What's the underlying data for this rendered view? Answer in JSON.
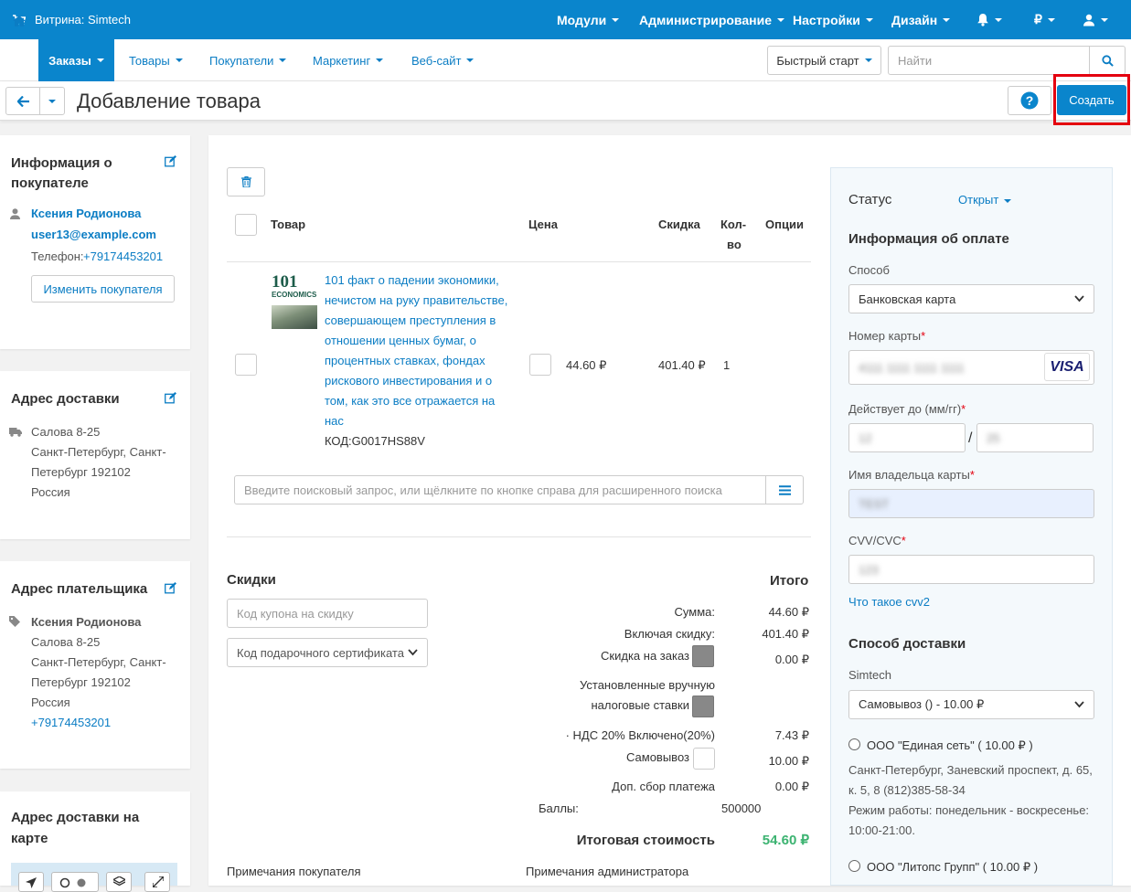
{
  "topbar": {
    "brand": "Витрина: Simtech",
    "menu": [
      "Модули",
      "Администрирование",
      "Настройки",
      "Дизайн"
    ],
    "currency": "₽"
  },
  "secnav": {
    "items": [
      "Заказы",
      "Товары",
      "Покупатели",
      "Маркетинг",
      "Веб-сайт"
    ],
    "quick_start": "Быстрый старт",
    "search_placeholder": "Найти"
  },
  "header": {
    "title": "Добавление товара",
    "create_label": "Создать"
  },
  "customer": {
    "title": "Информация о покупателе",
    "name": "Ксения Родионова",
    "email": "user13@example.com",
    "phone_label": "Телефон:",
    "phone": "+79174453201",
    "change_label": "Изменить покупателя"
  },
  "shipping_address": {
    "title": "Адрес доставки",
    "lines": [
      "Салова 8-25",
      "Санкт-Петербург, Санкт-",
      "Петербург 192102",
      "Россия"
    ]
  },
  "billing_address": {
    "title": "Адрес плательщика",
    "name": "Ксения Родионова",
    "lines": [
      "Салова 8-25",
      "Санкт-Петербург, Санкт-",
      "Петербург 192102",
      "Россия"
    ],
    "phone": "+79174453201"
  },
  "map": {
    "title_line1": "Адрес доставки на",
    "title_line2": "карте"
  },
  "products": {
    "columns": {
      "product": "Товар",
      "price": "Цена",
      "discount": "Скидка",
      "qty_line1": "Кол-",
      "qty_line2": "во",
      "options": "Опции"
    },
    "thumb_text1": "101",
    "thumb_text2": "ECONOMICS",
    "item": {
      "name_lines": [
        "101 факт о падении экономики,",
        "нечистом на руку правительстве,",
        "совершающем преступления в",
        "отношении ценных бумаг, о",
        "процентных ставках, фондах",
        "рискового инвестирования и о",
        "том, как это все отражается на",
        "нас"
      ],
      "code": "КОД:G0017HS88V",
      "price": "44.60 ₽",
      "discount": "401.40 ₽",
      "qty": "1"
    },
    "search_placeholder": "Введите поисковый запрос, или щёлкните по кнопке справа для расширенного поиска"
  },
  "discounts": {
    "title": "Скидки",
    "coupon_placeholder": "Код купона на скидку",
    "gift_select": "Код подарочного сертификата"
  },
  "totals": {
    "title": "Итого",
    "rows": [
      {
        "label": "Сумма:",
        "value": "44.60 ₽"
      },
      {
        "label": "Включая скидку:",
        "value": "401.40 ₽"
      },
      {
        "label": "Скидка на заказ",
        "value": "0.00 ₽"
      },
      {
        "label": "Установленные вручную",
        "value": ""
      },
      {
        "label": "налоговые ставки",
        "value": ""
      },
      {
        "label": "· НДС 20% Включено(20%)",
        "value": "7.43 ₽"
      },
      {
        "label": "Самовывоз",
        "value": "10.00 ₽"
      },
      {
        "label": "Доп. сбор платежа",
        "value": "0.00 ₽"
      }
    ],
    "points_label": "Баллы:",
    "points_value": "500000",
    "grand_label": "Итоговая стоимость",
    "grand_value": "54.60 ₽"
  },
  "notes": {
    "customer": "Примечания покупателя",
    "admin": "Примечания администратора"
  },
  "status": {
    "label": "Статус",
    "value": "Открыт"
  },
  "payment": {
    "title": "Информация об оплате",
    "method_label": "Способ",
    "method_value": "Банковская карта",
    "card_label": "Номер карты",
    "card_value": "4111 1111 1111 1111",
    "card_brand": "VISA",
    "valid_label": "Действует до (мм/гг)",
    "valid_mm": "12",
    "valid_yy": "25",
    "holder_label": "Имя владельца карты",
    "holder_value": "TEST",
    "cvv_label": "CVV/CVC",
    "cvv_value": "123",
    "cvv_help": "Что такое cvv2",
    "required": "*"
  },
  "shipping": {
    "title": "Способ доставки",
    "carrier": "Simtech",
    "selected": "Самовывоз () - 10.00 ₽",
    "options": [
      {
        "name": "ООО \"Единая сеть\" ( 10.00 ₽ )",
        "address_lines": [
          "Санкт-Петербург, Заневский проспект, д. 65,",
          "к. 5, 8 (812)385-58-34",
          "Режим работы: понедельник - воскресенье:",
          "10:00-21:00."
        ]
      },
      {
        "name": "ООО \"Литопс Групп\" ( 10.00 ₽ )"
      }
    ]
  },
  "colors": {
    "primary": "#0a85cc",
    "link": "#0b7dc4",
    "total_green": "#3cb371",
    "highlight_red": "#e4000f"
  }
}
